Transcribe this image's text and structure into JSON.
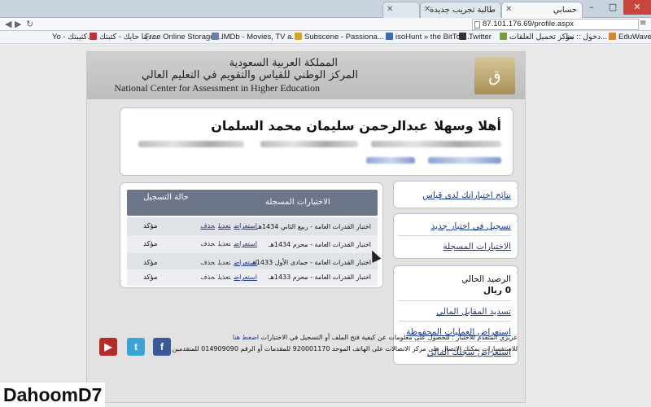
{
  "browser": {
    "tabs": [
      {
        "label": "حسابي"
      },
      {
        "label": "طالبة تجريب جديدة"
      },
      {
        "label": ""
      }
    ],
    "url": "87.101.176.69/profile.aspx",
    "bookmarks": [
      {
        "label": "Yo - كتيبتك..."
      },
      {
        "label": "دينا حايك - كتبتك..."
      },
      {
        "label": "Free Online Storage ..."
      },
      {
        "label": "IMDb - Movies, TV a..."
      },
      {
        "label": "Subscene - Passiona..."
      },
      {
        "label": "isoHunt » the BitTorr..."
      },
      {
        "label": "Twitter"
      },
      {
        "label": "مركز تحميل العلقات"
      },
      {
        "label": "دخول :: نظ..."
      },
      {
        "label": "EduWave"
      }
    ]
  },
  "header": {
    "line1": "المملكة العربية السعودية",
    "line2": "المركز الوطني للقياس والتقويم في التعليم العالي",
    "english": "National Center for Assessment in Higher Education"
  },
  "welcome": {
    "greeting": "أهلا وسهلا",
    "name": "عبدالرحمن سليمان محمد السلمان"
  },
  "exams": {
    "col_exams": "الاختبارات المسجلة",
    "col_status": "حالة التسجيل",
    "rows": [
      {
        "name": "اختبار القدرات العامة - ربيع الثاني 1434هـ",
        "actions": [
          "استعراض",
          "تعديل",
          "حذف"
        ],
        "status": "مؤكد"
      },
      {
        "name": "اختبار القدرات العامة - محرم 1434هـ",
        "actions": [
          "استعراض",
          "تعديل",
          "حذف"
        ],
        "status": "مؤكد"
      },
      {
        "name": "اختبار القدرات العامة - جمادى الأول 1433هـ",
        "actions": [
          "استعراض",
          "تعديل",
          "حذف"
        ],
        "status": "مؤكد"
      },
      {
        "name": "اختبار القدرات العامة - محرم 1433هـ",
        "actions": [
          "استعراض",
          "تعديل",
          "حذف"
        ],
        "status": "مؤكد"
      }
    ]
  },
  "sidebar": {
    "results_link": "نتائج اختباراتك لدى قياس",
    "register_link": "تسجيل في اختبار جديد",
    "registered_link": "الاختبارات المسجلة",
    "balance_label": "الرصيد الحالي",
    "balance_value": "0 ريال",
    "pay_link": "تسديد المقابل المالي",
    "saved_ops_link": "استعراض العمليات المحفوظة",
    "financial_log_link": "استعراض سجلك المالي"
  },
  "footer": {
    "line1_prefix": "عزيزي المتقدم للاختبار : للحصول على معلومات عن كيفية فتح الملف أو التسجيل في الاختبارات",
    "line1_link": "اضغط هنا",
    "line2": "للاستفسارات يمكنك الاتصال على مركز الاتصالات على الهاتف الموحد 920001170 للمقدمات أو الرقم 014909090 للمتقدمين"
  },
  "watermark": "DahoomD7",
  "colors": {
    "table_header": "#6d7689",
    "link": "#1c3a8c"
  }
}
